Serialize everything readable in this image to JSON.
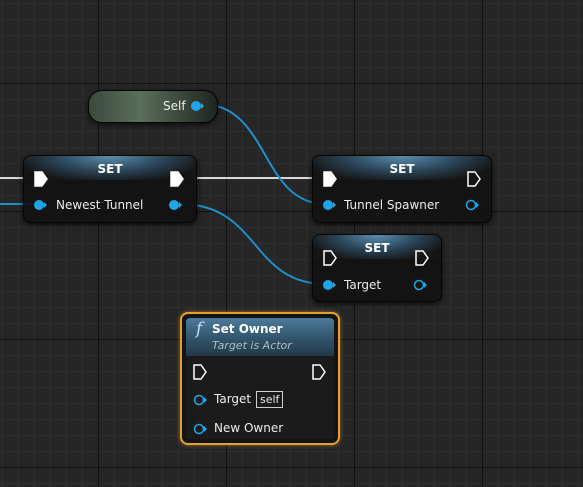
{
  "colors": {
    "grid_bg": "#262626",
    "pin_object": "#1fa6e8",
    "wire_exec": "#d8d8d8",
    "wire_object": "#1f8fc9",
    "function_border": "#e49f2c",
    "header_blue": "#3c6a87"
  },
  "self_node": {
    "label": "Self"
  },
  "set_newest_tunnel": {
    "title": "SET",
    "var_label": "Newest Tunnel"
  },
  "set_tunnel_spawner": {
    "title": "SET",
    "var_label": "Tunnel Spawner"
  },
  "set_target": {
    "title": "SET",
    "var_label": "Target"
  },
  "set_owner": {
    "function_icon": "f",
    "title": "Set Owner",
    "subtitle": "Target is Actor",
    "target_label": "Target",
    "target_default": "self",
    "new_owner_label": "New Owner"
  }
}
